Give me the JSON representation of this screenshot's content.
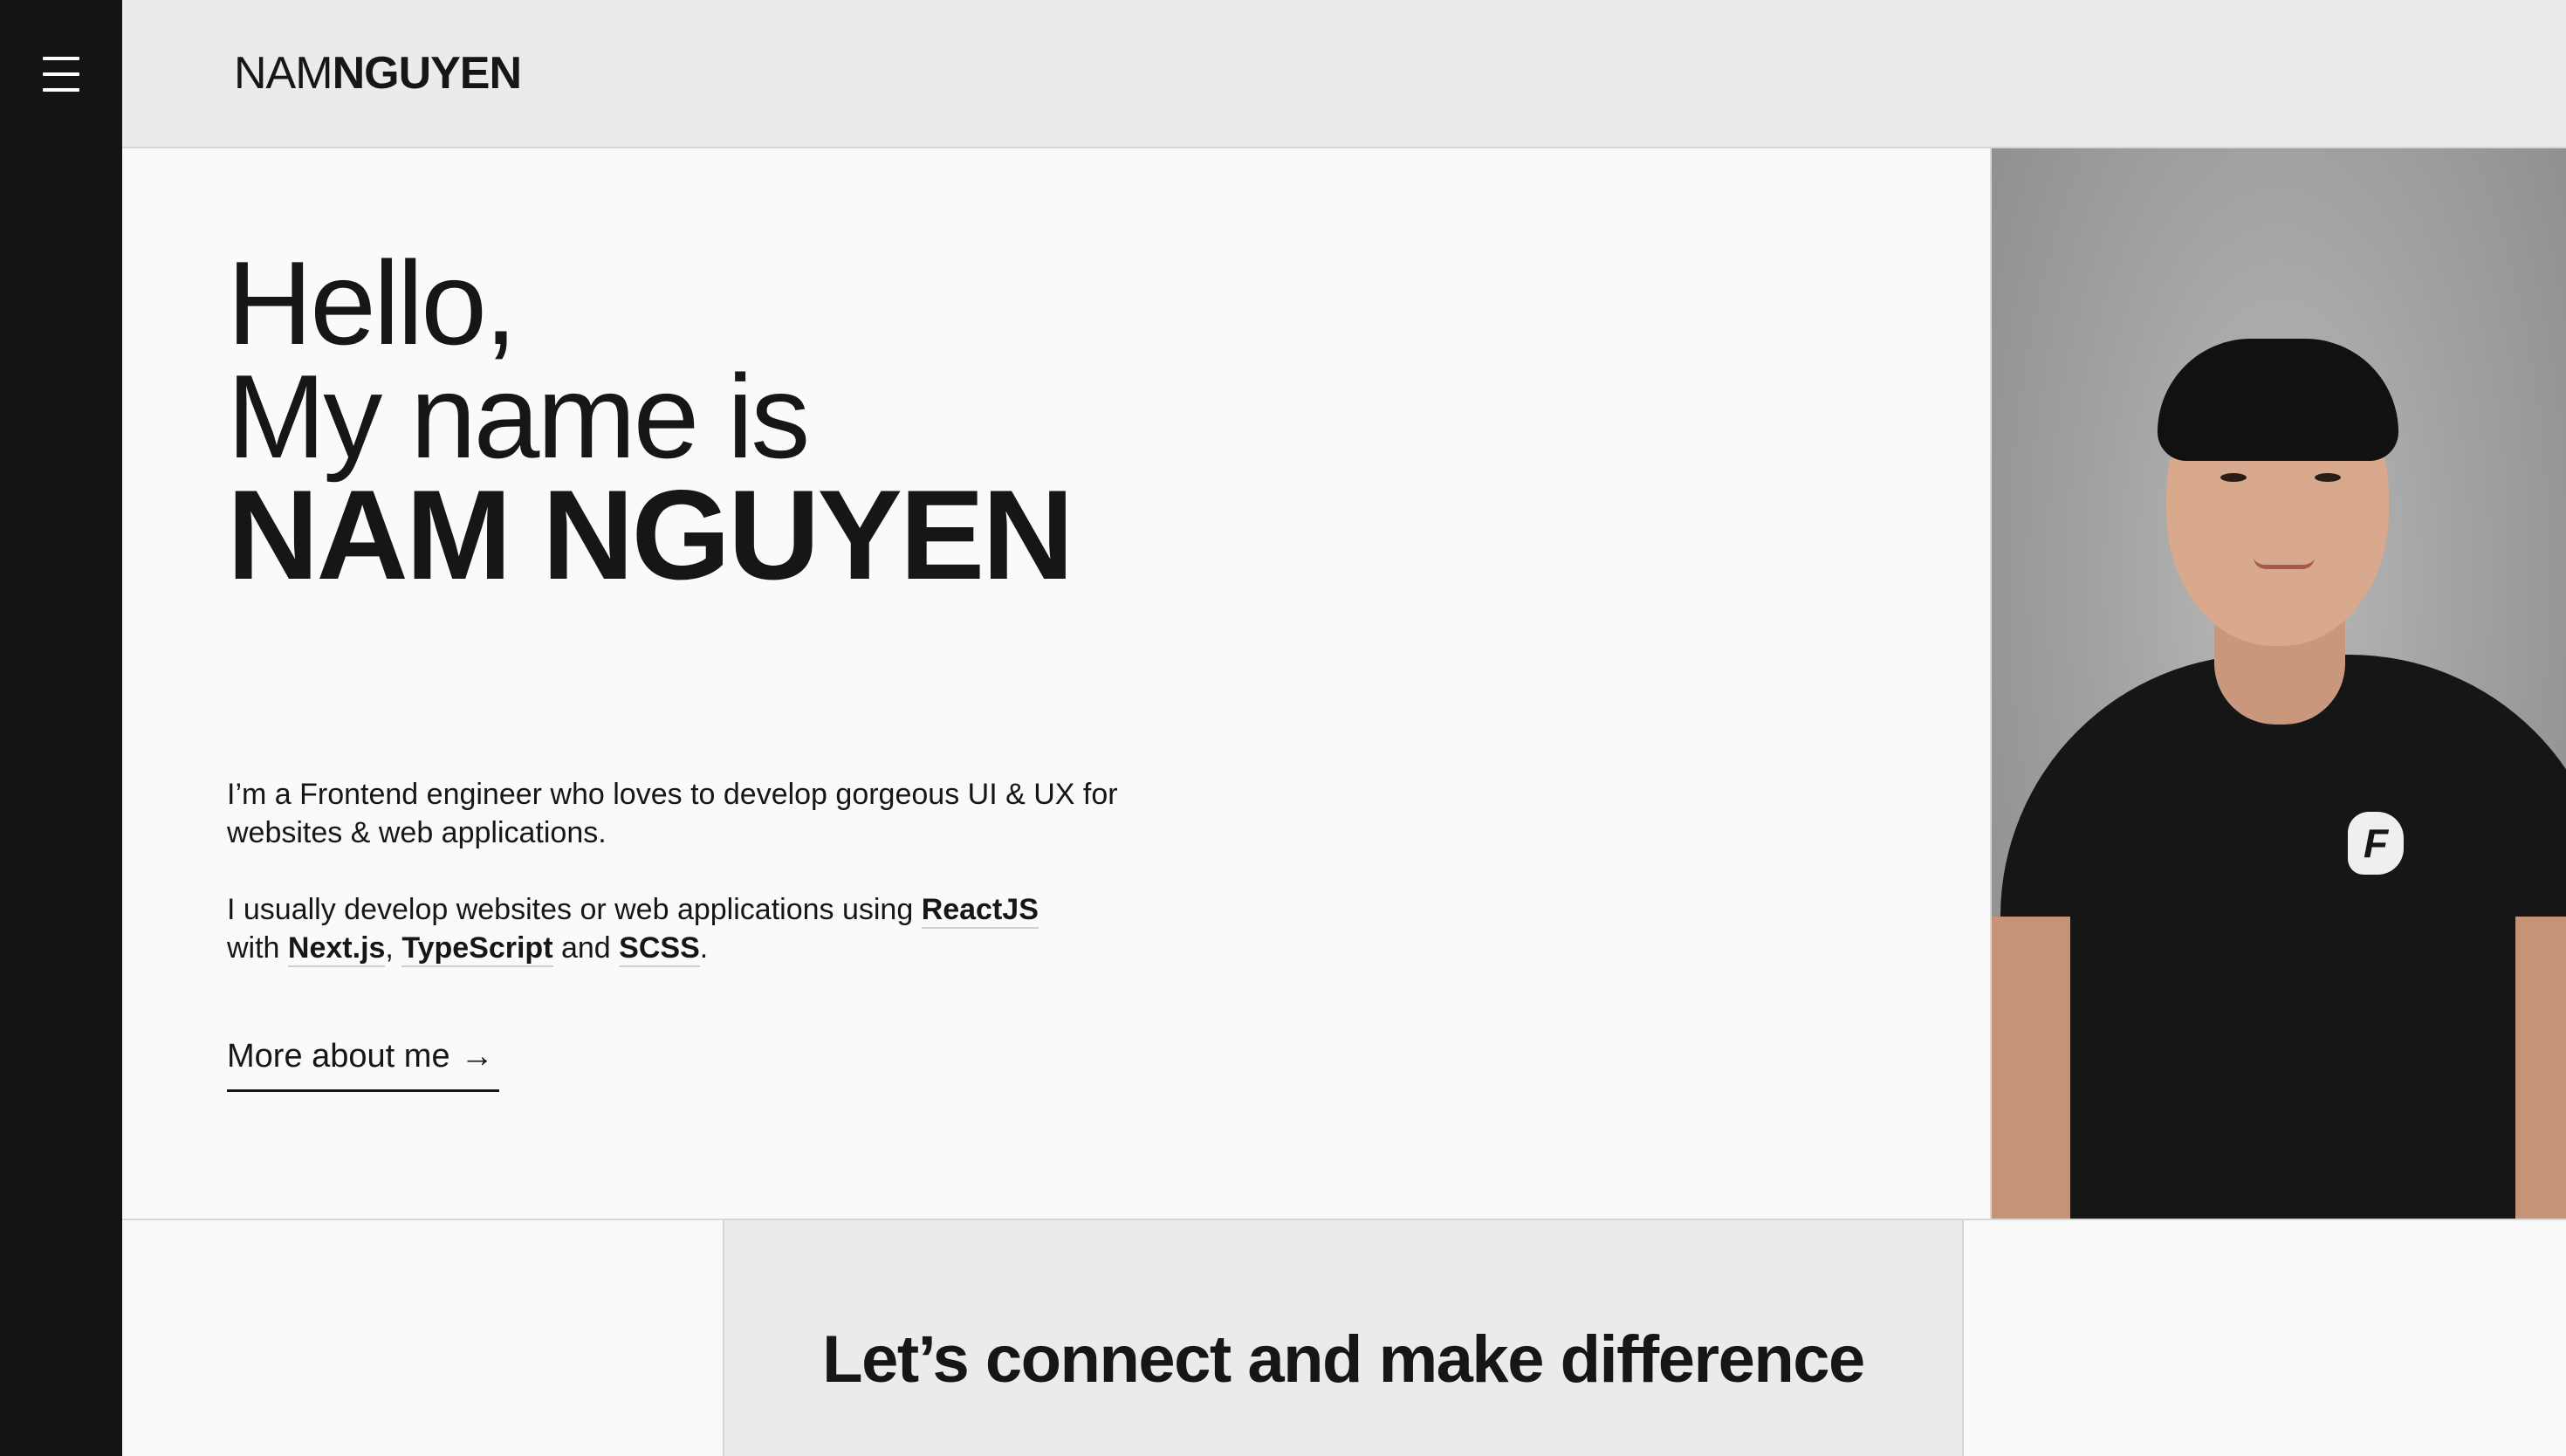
{
  "header": {
    "logo_light": "NAM",
    "logo_bold": "NGUYEN"
  },
  "sidebar": {
    "menu_icon": "hamburger-menu-icon"
  },
  "hero": {
    "greeting": "Hello,",
    "intro_line": "My name is",
    "name": "NAM NGUYEN",
    "bio_1": "I’m a Frontend engineer who loves to develop gorgeous UI & UX for websites & web applications.",
    "bio_2_prefix": "I usually develop websites or web applications using",
    "bio_2_with": "with",
    "bio_2_and": "and",
    "bio_2_end": ".",
    "tech": {
      "react": "ReactJS",
      "next": "Next.js",
      "typescript": "TypeScript",
      "scss": "SCSS"
    },
    "more_link": "More about me",
    "more_arrow": "→"
  },
  "photo": {
    "badge_letter": "F"
  },
  "footer_section": {
    "title": "Let’s connect and make difference"
  },
  "colors": {
    "sidebar_bg": "#141414",
    "header_bg": "#ebebeb",
    "page_bg": "#fafafa",
    "text": "#161616",
    "divider": "#d6d6d6"
  }
}
